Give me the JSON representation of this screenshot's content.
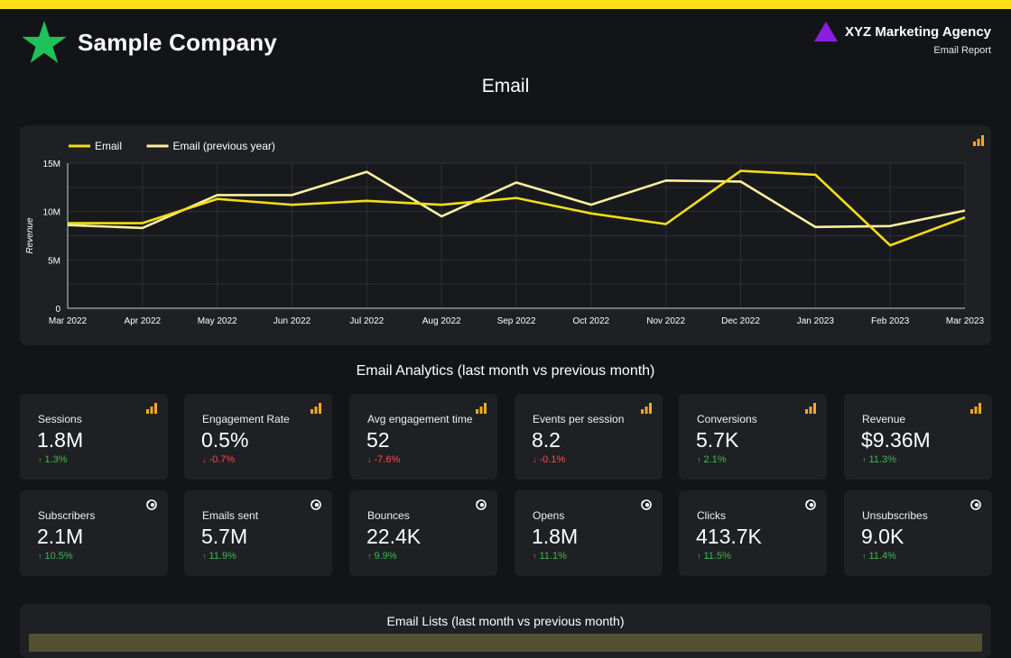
{
  "brand": {
    "company": "Sample Company",
    "star_color": "#1fc25a"
  },
  "agency": {
    "name": "XYZ Marketing Agency",
    "subtitle": "Email Report",
    "logo_color": "#8a1ee0"
  },
  "page_title": "Email",
  "colors": {
    "accent": "#ffe11a",
    "series_email": "#f3dd1a",
    "series_prev": "#fdf0a0",
    "up": "#3fb950",
    "down": "#ff4a4a",
    "card": "#1f2024"
  },
  "chart_data": {
    "type": "line",
    "ylabel": "Revenue",
    "xlabel": "",
    "x": [
      "Mar 2022",
      "Apr 2022",
      "May 2022",
      "Jun 2022",
      "Jul 2022",
      "Aug 2022",
      "Sep 2022",
      "Oct 2022",
      "Nov 2022",
      "Dec 2022",
      "Jan 2023",
      "Feb 2023",
      "Mar 2023"
    ],
    "yticks": [
      0,
      5000000,
      10000000,
      15000000
    ],
    "ytick_labels": [
      "0",
      "5M",
      "10M",
      "15M"
    ],
    "ylim": [
      0,
      15000000
    ],
    "grid": true,
    "legend": "top-left",
    "series": [
      {
        "name": "Email",
        "values": [
          8800000,
          8800000,
          11300000,
          10700000,
          11100000,
          10700000,
          11400000,
          9800000,
          8700000,
          14200000,
          13800000,
          6500000,
          9400000
        ]
      },
      {
        "name": "Email (previous year)",
        "values": [
          8600000,
          8300000,
          11700000,
          11700000,
          14100000,
          9500000,
          13000000,
          10700000,
          13200000,
          13100000,
          8400000,
          8500000,
          10100000
        ]
      }
    ]
  },
  "section_title": "Email Analytics (last month vs previous month)",
  "kpis": [
    {
      "label": "Sessions",
      "value": "1.8M",
      "delta": "1.3%",
      "dir": "up",
      "icon": "bar-chart-icon"
    },
    {
      "label": "Engagement Rate",
      "value": "0.5%",
      "delta": "-0.7%",
      "dir": "down",
      "icon": "bar-chart-icon"
    },
    {
      "label": "Avg engagement time",
      "value": "52",
      "delta": "-7.6%",
      "dir": "down",
      "icon": "bar-chart-icon"
    },
    {
      "label": "Events per session",
      "value": "8.2",
      "delta": "-0.1%",
      "dir": "down",
      "icon": "bar-chart-icon"
    },
    {
      "label": "Conversions",
      "value": "5.7K",
      "delta": "2.1%",
      "dir": "up",
      "icon": "bar-chart-icon"
    },
    {
      "label": "Revenue",
      "value": "$9.36M",
      "delta": "11.3%",
      "dir": "up",
      "icon": "bar-chart-icon"
    },
    {
      "label": "Subscribers",
      "value": "2.1M",
      "delta": "10.5%",
      "dir": "up",
      "icon": "monkey-icon"
    },
    {
      "label": "Emails sent",
      "value": "5.7M",
      "delta": "11.9%",
      "dir": "up",
      "icon": "monkey-icon"
    },
    {
      "label": "Bounces",
      "value": "22.4K",
      "delta": "9.9%",
      "dir": "up",
      "icon": "monkey-icon"
    },
    {
      "label": "Opens",
      "value": "1.8M",
      "delta": "11.1%",
      "dir": "up",
      "icon": "monkey-icon"
    },
    {
      "label": "Clicks",
      "value": "413.7K",
      "delta": "11.5%",
      "dir": "up",
      "icon": "monkey-icon"
    },
    {
      "label": "Unsubscribes",
      "value": "9.0K",
      "delta": "11.4%",
      "dir": "up",
      "icon": "monkey-icon"
    }
  ],
  "lists_title": "Email Lists (last month vs previous month)"
}
